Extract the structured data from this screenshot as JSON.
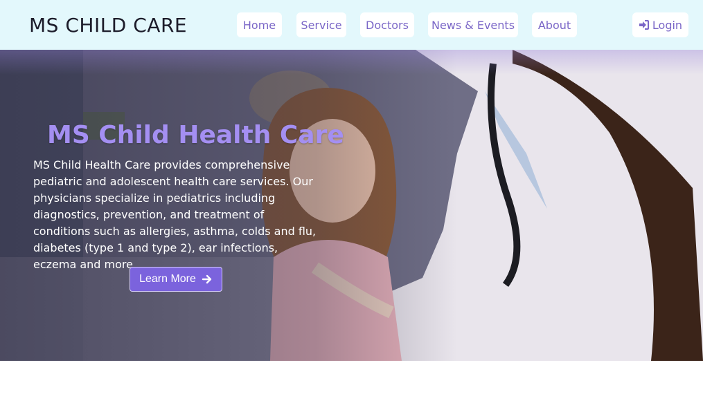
{
  "brand": "MS CHILD CARE",
  "nav": {
    "home": "Home",
    "service": "Service",
    "doctors": "Doctors",
    "news": "News & Events",
    "about": "About",
    "login": "Login"
  },
  "hero": {
    "title": "MS Child Health Care",
    "description": "MS Child Health Care provides comprehensive pediatric and adolescent health care services. Our physicians specialize in pediatrics including diagnostics, prevention, and treatment of conditions such as allergies, asthma, colds and flu, diabetes (type 1 and type 2), ear infections, eczema and more.",
    "button": "Learn More"
  },
  "colors": {
    "navbar_bg": "#e3f8fc",
    "accent": "#7b63dd",
    "title": "#a48ff2",
    "nav_text": "#7a66c7"
  },
  "icons": {
    "login": "sign-in-icon",
    "learn_more": "arrow-right-icon"
  }
}
